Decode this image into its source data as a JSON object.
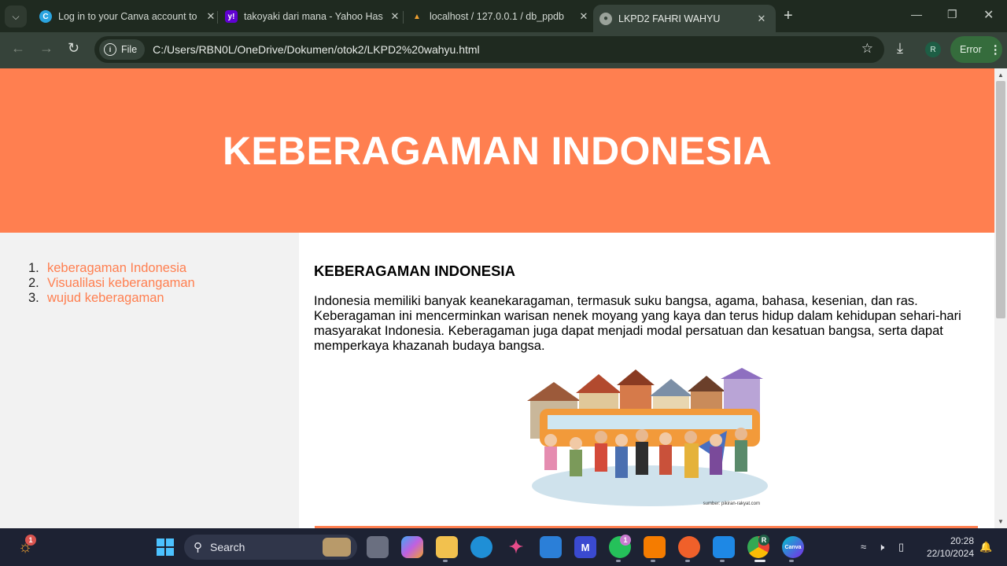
{
  "browser": {
    "tabs": [
      {
        "title": "Log in to your Canva account to",
        "icon": "canva-icon",
        "active": false
      },
      {
        "title": "takoyaki dari mana - Yahoo Has",
        "icon": "yahoo-icon",
        "active": false
      },
      {
        "title": "localhost / 127.0.0.1 / db_ppdb",
        "icon": "phpmyadmin-icon",
        "active": false
      },
      {
        "title": "LKPD2 FAHRI WAHYU",
        "icon": "globe-icon",
        "active": true
      }
    ],
    "chip_label": "File",
    "url": "C:/Users/RBN0L/OneDrive/Dokumen/otok2/LKPD2%20wahyu.html",
    "profile_initial": "R",
    "error_label": "Error"
  },
  "page": {
    "header_title": "KEBERAGAMAN INDONESIA",
    "nav": [
      {
        "num": "1.",
        "label": "keberagaman Indonesia"
      },
      {
        "num": "2.",
        "label": "Visualilasi keberangaman"
      },
      {
        "num": "3.",
        "label": "wujud keberagaman"
      }
    ],
    "section_title": "KEBERAGAMAN INDONESIA",
    "paragraph": "Indonesia memiliki banyak keanekaragaman, termasuk suku bangsa, agama, bahasa, kesenian, dan ras. Keberagaman ini mencerminkan warisan nenek moyang yang kaya dan terus hidup dalam kehidupan sehari-hari masyarakat Indonesia. Keberagaman juga dapat menjadi modal persatuan dan kesatuan bangsa, serta dapat memperkaya khazanah budaya bangsa.",
    "image_caption": "sumber: pikiran-rakyat.com",
    "accent_color": "#ff7f50"
  },
  "taskbar": {
    "search_label": "Search",
    "time": "20:28",
    "date": "22/10/2024",
    "widget_badge": "1",
    "whatsapp_badge": "1",
    "chrome_profile": "R"
  }
}
